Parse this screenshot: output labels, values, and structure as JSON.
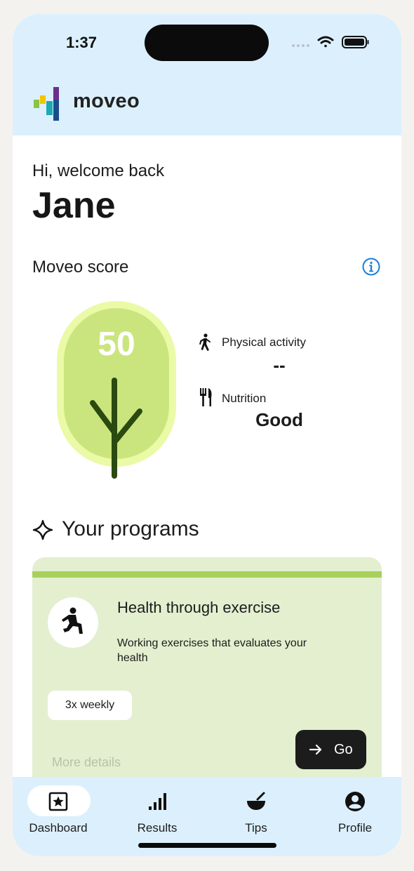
{
  "status_bar": {
    "time": "1:37"
  },
  "brand": {
    "name": "moveo"
  },
  "greeting": {
    "line": "Hi, welcome back",
    "name": "Jane"
  },
  "score_section": {
    "title": "Moveo score",
    "score": "50",
    "metrics": [
      {
        "label": "Physical activity",
        "value": "--",
        "icon": "walking-person-icon"
      },
      {
        "label": "Nutrition",
        "value": "Good",
        "icon": "fork-knife-icon"
      }
    ]
  },
  "programs": {
    "title": "Your programs",
    "card": {
      "title": "Health through exercise",
      "description": "Working exercises that evaluates your health",
      "frequency": "3x weekly",
      "more_details": "More details",
      "go_label": "Go",
      "icon": "lunge-exercise-icon"
    }
  },
  "nav": {
    "items": [
      {
        "label": "Dashboard",
        "icon": "star-box-icon",
        "active": true
      },
      {
        "label": "Results",
        "icon": "bar-chart-icon",
        "active": false
      },
      {
        "label": "Tips",
        "icon": "bowl-icon",
        "active": false
      },
      {
        "label": "Profile",
        "icon": "user-circle-icon",
        "active": false
      }
    ]
  },
  "colors": {
    "header_bg": "#dbf0fc",
    "card_bg": "#e3efcf",
    "card_stripe": "#a8d05c",
    "tree_leaf": "#cbe57e",
    "tree_glow": "#eafaa6",
    "tree_trunk": "#2b4a10",
    "info_accent": "#1a7fd6"
  }
}
